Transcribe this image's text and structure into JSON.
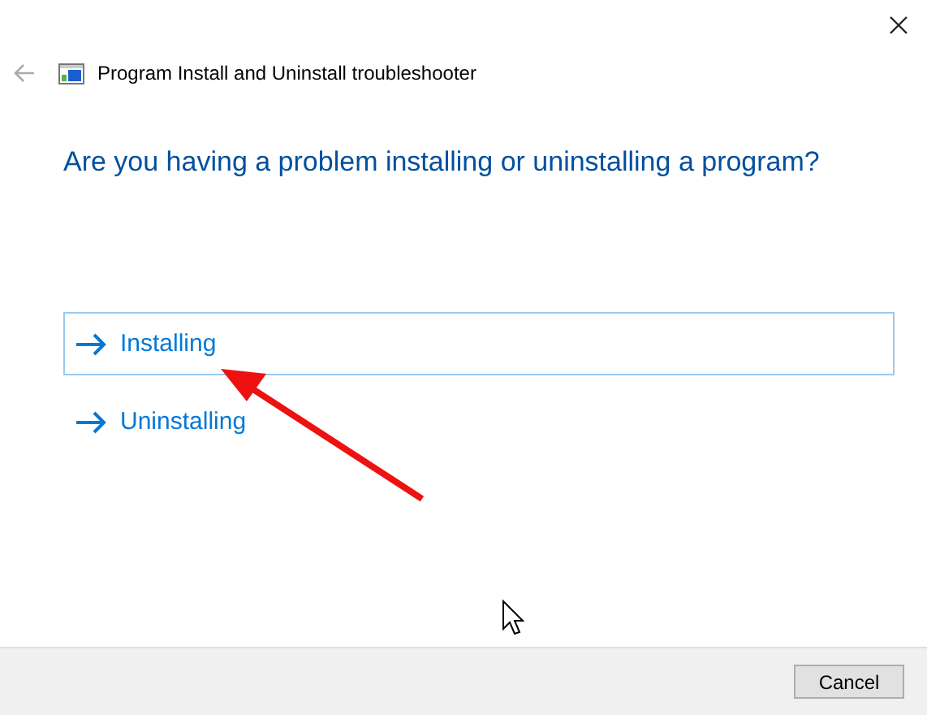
{
  "window": {
    "title": "Program Install and Uninstall troubleshooter"
  },
  "heading": "Are you having a problem installing or uninstalling a program?",
  "options": [
    {
      "label": "Installing",
      "selected": true
    },
    {
      "label": "Uninstalling",
      "selected": false
    }
  ],
  "buttons": [
    "Cancel"
  ]
}
